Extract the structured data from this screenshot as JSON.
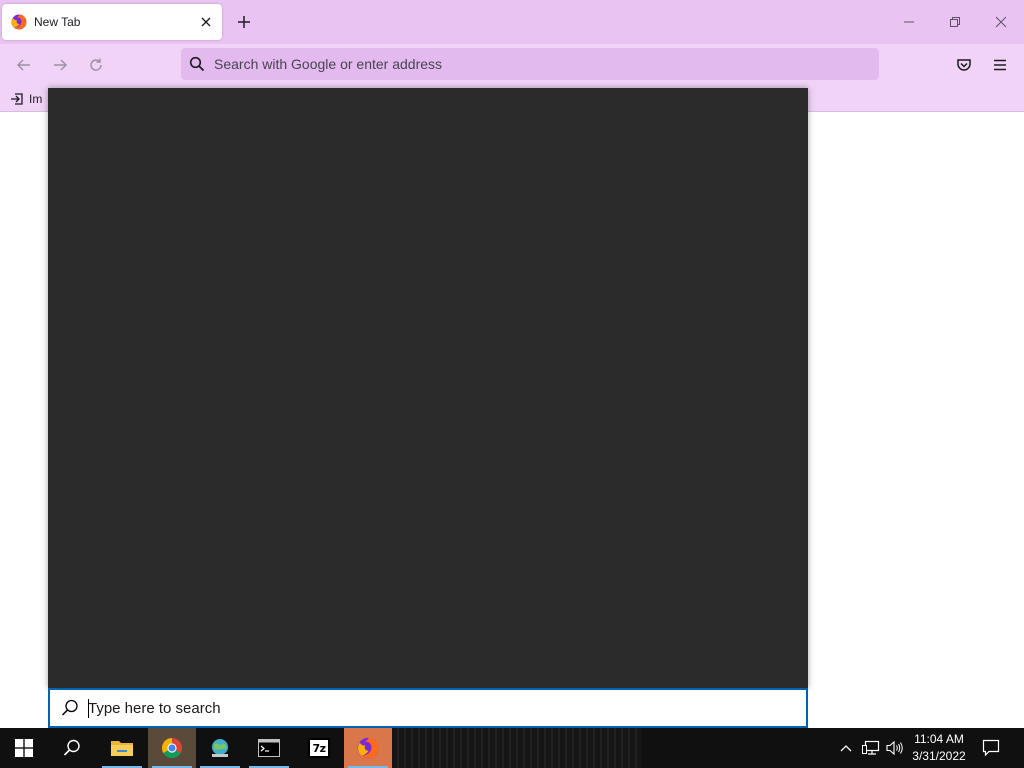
{
  "browser": {
    "tab": {
      "title": "New Tab"
    },
    "urlbar": {
      "placeholder": "Search with Google or enter address"
    },
    "bookmarks_toolbar": {
      "import_label": "Im"
    },
    "theme": {
      "tabstrip_bg": "#e9c4f2",
      "toolbar_bg": "#f0d3f7",
      "urlbar_bg": "#e2baee"
    }
  },
  "start_search": {
    "placeholder": "Type here to search",
    "panel_bg": "#2b2b2b",
    "accent": "#0063b1"
  },
  "taskbar": {
    "apps": [
      {
        "icon": "file-explorer-icon",
        "running": true
      },
      {
        "icon": "chrome-icon",
        "running": true
      },
      {
        "icon": "network-globe-icon",
        "running": true
      },
      {
        "icon": "command-prompt-icon",
        "running": true
      },
      {
        "icon": "7zip-icon",
        "label": "7z",
        "running": false
      },
      {
        "icon": "firefox-icon",
        "running": true,
        "active": true
      }
    ],
    "clock": {
      "time": "11:04 AM",
      "date": "3/31/2022"
    }
  }
}
